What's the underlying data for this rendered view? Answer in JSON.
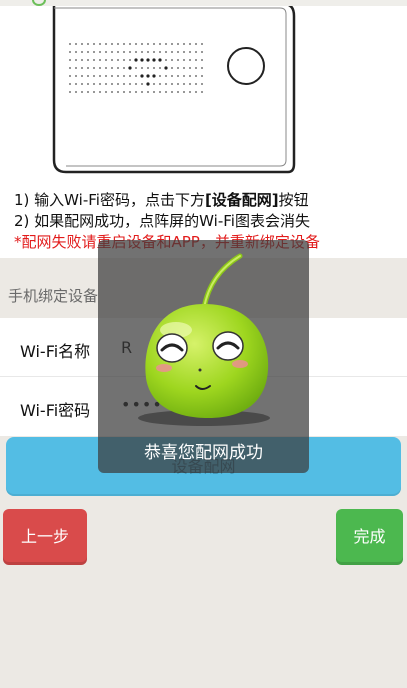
{
  "instructions": {
    "line1_pre": "1) 输入Wi-Fi密码，点击下方",
    "line1_bold": "[设备配网]",
    "line1_post": "按钮",
    "line2": "2) 如果配网成功，点阵屏的Wi-Fi图表会消失",
    "warning": "*配网失败请重启设备和APP，并重新绑定设备"
  },
  "section": {
    "title": "手机绑定设备"
  },
  "form": {
    "ssid_label": "Wi-Fi名称",
    "ssid_value": "R",
    "password_label": "Wi-Fi密码",
    "password_value": "••••"
  },
  "buttons": {
    "config": "设备配网",
    "prev": "上一步",
    "done": "完成"
  },
  "toast": {
    "message": "恭喜您配网成功"
  },
  "colors": {
    "config_button": "#53bde4",
    "prev_button": "#d94b4b",
    "done_button": "#4cb84f",
    "warning_text": "#e21b1b"
  },
  "icons": {
    "device": "device-illustration",
    "mascot": "green-bean-mascot"
  }
}
